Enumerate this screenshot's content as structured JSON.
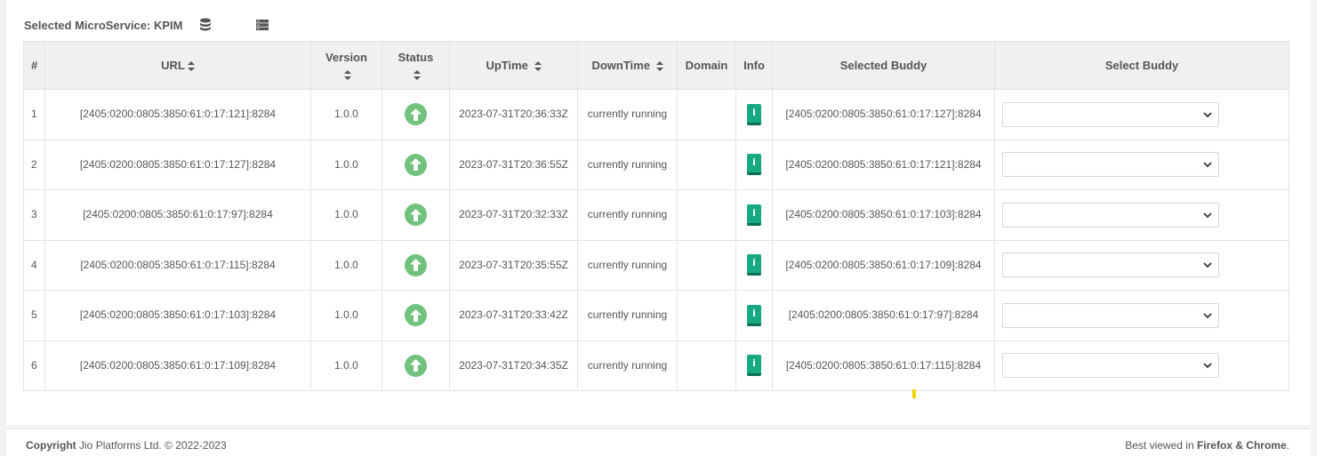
{
  "header": {
    "label": "Selected MicroService: KPIM",
    "db_icon": "database-icon",
    "server_icon": "server-icon"
  },
  "table": {
    "columns": {
      "index": "#",
      "url": "URL",
      "version": "Version",
      "status": "Status",
      "uptime": "UpTime",
      "downtime": "DownTime",
      "domain": "Domain",
      "info": "Info",
      "selected_buddy": "Selected Buddy",
      "select_buddy": "Select Buddy"
    },
    "rows": [
      {
        "index": "1",
        "url": "[2405:0200:0805:3850:61:0:17:121]:8284",
        "version": "1.0.0",
        "status": "up",
        "uptime": "2023-07-31T20:36:33Z",
        "downtime": "currently running",
        "domain": "",
        "info": "i",
        "selected_buddy": "[2405:0200:0805:3850:61:0:17:127]:8284",
        "select_buddy": ""
      },
      {
        "index": "2",
        "url": "[2405:0200:0805:3850:61:0:17:127]:8284",
        "version": "1.0.0",
        "status": "up",
        "uptime": "2023-07-31T20:36:55Z",
        "downtime": "currently running",
        "domain": "",
        "info": "i",
        "selected_buddy": "[2405:0200:0805:3850:61:0:17:121]:8284",
        "select_buddy": ""
      },
      {
        "index": "3",
        "url": "[2405:0200:0805:3850:61:0:17:97]:8284",
        "version": "1.0.0",
        "status": "up",
        "uptime": "2023-07-31T20:32:33Z",
        "downtime": "currently running",
        "domain": "",
        "info": "i",
        "selected_buddy": "[2405:0200:0805:3850:61:0:17:103]:8284",
        "select_buddy": ""
      },
      {
        "index": "4",
        "url": "[2405:0200:0805:3850:61:0:17:115]:8284",
        "version": "1.0.0",
        "status": "up",
        "uptime": "2023-07-31T20:35:55Z",
        "downtime": "currently running",
        "domain": "",
        "info": "i",
        "selected_buddy": "[2405:0200:0805:3850:61:0:17:109]:8284",
        "select_buddy": ""
      },
      {
        "index": "5",
        "url": "[2405:0200:0805:3850:61:0:17:103]:8284",
        "version": "1.0.0",
        "status": "up",
        "uptime": "2023-07-31T20:33:42Z",
        "downtime": "currently running",
        "domain": "",
        "info": "i",
        "selected_buddy": "[2405:0200:0805:3850:61:0:17:97]:8284",
        "select_buddy": ""
      },
      {
        "index": "6",
        "url": "[2405:0200:0805:3850:61:0:17:109]:8284",
        "version": "1.0.0",
        "status": "up",
        "uptime": "2023-07-31T20:34:35Z",
        "downtime": "currently running",
        "domain": "",
        "info": "i",
        "selected_buddy": "[2405:0200:0805:3850:61:0:17:115]:8284",
        "select_buddy": ""
      }
    ]
  },
  "footer": {
    "copyright_label": "Copyright",
    "copyright_text": "Jio Platforms Ltd. © 2022-2023",
    "best_viewed_prefix": "Best viewed in",
    "best_viewed_browsers": "Firefox & Chrome",
    "best_viewed_suffix": "."
  },
  "colors": {
    "status_up": "#71c27c",
    "info_button": "#17a980",
    "header_bg": "#f0f0f0"
  }
}
